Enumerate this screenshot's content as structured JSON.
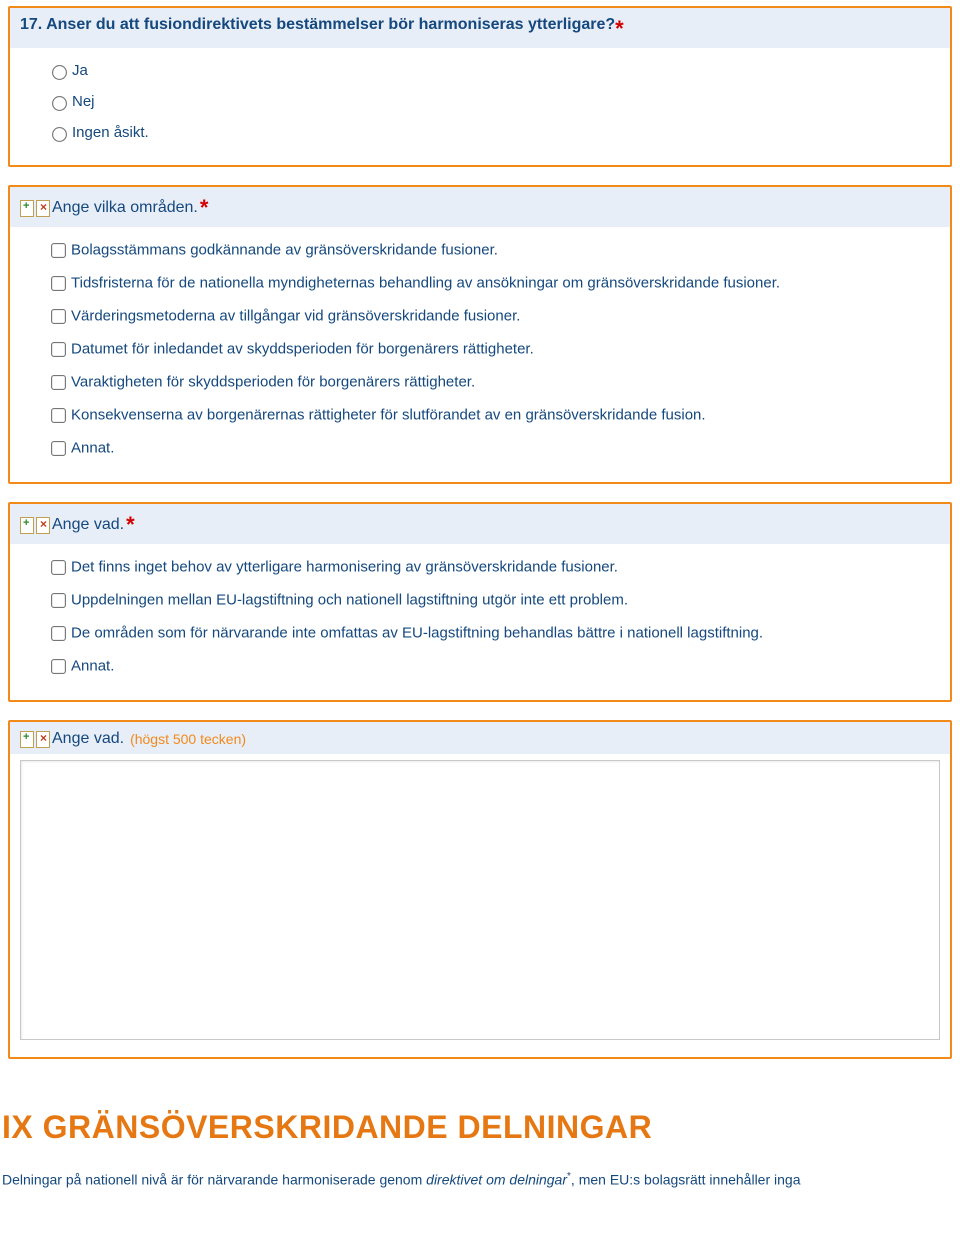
{
  "q17": {
    "title": "17. Anser du att fusiondirektivets bestämmelser bör harmoniseras ytterligare?",
    "options": [
      "Ja",
      "Nej",
      "Ingen åsikt."
    ]
  },
  "areas": {
    "title": "Ange vilka områden.",
    "options": [
      "Bolagsstämmans godkännande av gränsöverskridande fusioner.",
      "Tidsfristerna för de nationella myndigheternas behandling av ansökningar om gränsöverskridande fusioner.",
      "Värderingsmetoderna av tillgångar vid gränsöverskridande fusioner.",
      "Datumet för inledandet av skyddsperioden för borgenärers rättigheter.",
      "Varaktigheten för skyddsperioden för borgenärers rättigheter.",
      "Konsekvenserna av borgenärernas rättigheter för slutförandet av en gränsöverskridande fusion.",
      "Annat."
    ]
  },
  "what": {
    "title": "Ange vad.",
    "options": [
      "Det finns inget behov av ytterligare harmonisering av gränsöverskridande fusioner.",
      "Uppdelningen mellan EU-lagstiftning och nationell lagstiftning utgör inte ett problem.",
      "De områden som för närvarande inte omfattas av EU-lagstiftning behandlas bättre i nationell lagstiftning.",
      "Annat."
    ]
  },
  "what2": {
    "title": "Ange vad.",
    "limit": "(högst 500 tecken)"
  },
  "section": {
    "heading": "IX GRÄNSÖVERSKRIDANDE DELNINGAR",
    "foot_pre": "Delningar på nationell nivå är för närvarande harmoniserade genom ",
    "foot_ital": "direktivet om delningar",
    "foot_post": ", men EU:s bolagsrätt innehåller inga"
  }
}
